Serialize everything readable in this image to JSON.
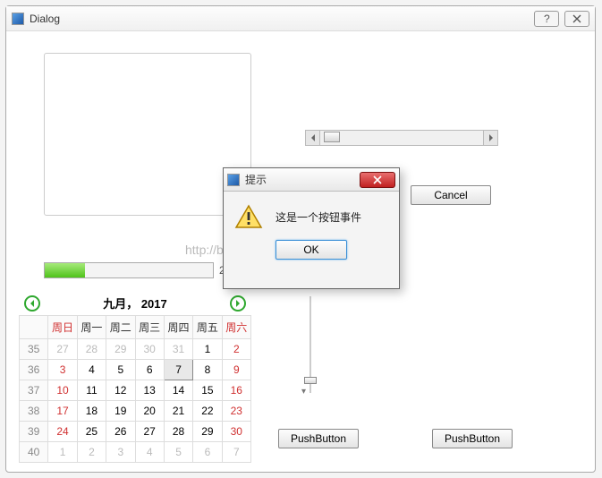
{
  "window": {
    "title": "Dialog",
    "help_tooltip": "Help",
    "close_tooltip": "Close"
  },
  "scrollbar": {
    "min": 0,
    "max": 100,
    "value": 2
  },
  "cancel_label": "Cancel",
  "pushbutton_label": "PushButton",
  "progress": {
    "value": 24,
    "display": "24"
  },
  "watermark": "http://blog.csdn.net/gucunlin",
  "calendar": {
    "title": "九月， 2017",
    "weeknum_header": "",
    "day_headers": [
      "周日",
      "周一",
      "周二",
      "周三",
      "周四",
      "周五",
      "周六"
    ],
    "rows": [
      {
        "wk": "35",
        "days": [
          {
            "n": "27",
            "g": true
          },
          {
            "n": "28",
            "g": true
          },
          {
            "n": "29",
            "g": true
          },
          {
            "n": "30",
            "g": true
          },
          {
            "n": "31",
            "g": true
          },
          {
            "n": "1"
          },
          {
            "n": "2",
            "r": true
          }
        ]
      },
      {
        "wk": "36",
        "days": [
          {
            "n": "3",
            "r": true
          },
          {
            "n": "4"
          },
          {
            "n": "5"
          },
          {
            "n": "6"
          },
          {
            "n": "7",
            "sel": true
          },
          {
            "n": "8"
          },
          {
            "n": "9",
            "r": true
          }
        ]
      },
      {
        "wk": "37",
        "days": [
          {
            "n": "10",
            "r": true
          },
          {
            "n": "11"
          },
          {
            "n": "12"
          },
          {
            "n": "13"
          },
          {
            "n": "14"
          },
          {
            "n": "15"
          },
          {
            "n": "16",
            "r": true
          }
        ]
      },
      {
        "wk": "38",
        "days": [
          {
            "n": "17",
            "r": true
          },
          {
            "n": "18"
          },
          {
            "n": "19"
          },
          {
            "n": "20"
          },
          {
            "n": "21"
          },
          {
            "n": "22"
          },
          {
            "n": "23",
            "r": true
          }
        ]
      },
      {
        "wk": "39",
        "days": [
          {
            "n": "24",
            "r": true
          },
          {
            "n": "25"
          },
          {
            "n": "26"
          },
          {
            "n": "27"
          },
          {
            "n": "28"
          },
          {
            "n": "29"
          },
          {
            "n": "30",
            "r": true
          }
        ]
      },
      {
        "wk": "40",
        "days": [
          {
            "n": "1",
            "g": true
          },
          {
            "n": "2",
            "g": true
          },
          {
            "n": "3",
            "g": true
          },
          {
            "n": "4",
            "g": true
          },
          {
            "n": "5",
            "g": true
          },
          {
            "n": "6",
            "g": true
          },
          {
            "n": "7",
            "g": true
          }
        ]
      }
    ]
  },
  "vslider": {
    "min": 0,
    "max": 100,
    "value": 10
  },
  "msgbox": {
    "title": "提示",
    "text": "这是一个按钮事件",
    "ok_label": "OK"
  }
}
